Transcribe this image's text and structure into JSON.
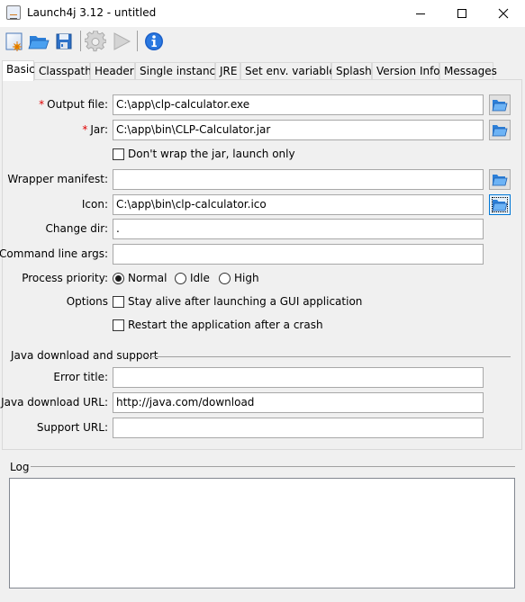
{
  "window": {
    "title": "Launch4j 3.12 - untitled",
    "minimize_label": "Minimize",
    "maximize_label": "Maximize",
    "close_label": "Close"
  },
  "toolbar": {
    "buttons": [
      {
        "name": "new-config",
        "icon": "new-document-icon"
      },
      {
        "name": "open-config",
        "icon": "open-folder-icon"
      },
      {
        "name": "save-config",
        "icon": "floppy-disk-icon"
      },
      {
        "name": "build-wrapper",
        "icon": "gear-icon"
      },
      {
        "name": "test-wrapper",
        "icon": "play-icon"
      },
      {
        "name": "about",
        "icon": "info-icon"
      }
    ]
  },
  "tabs": [
    {
      "label": "Basic",
      "active": true
    },
    {
      "label": "Classpath",
      "active": false
    },
    {
      "label": "Header",
      "active": false
    },
    {
      "label": "Single instance",
      "active": false
    },
    {
      "label": "JRE",
      "active": false
    },
    {
      "label": "Set env. variables",
      "active": false
    },
    {
      "label": "Splash",
      "active": false
    },
    {
      "label": "Version Info",
      "active": false
    },
    {
      "label": "Messages",
      "active": false
    }
  ],
  "basic": {
    "required_marker": "*",
    "output_file": {
      "label": "Output file:",
      "value": "C:\\app\\clp-calculator.exe"
    },
    "jar": {
      "label": "Jar:",
      "value": "C:\\app\\bin\\CLP-Calculator.jar"
    },
    "dont_wrap": {
      "label": "Don't wrap the jar, launch only",
      "checked": false
    },
    "wrapper_manifest": {
      "label": "Wrapper manifest:",
      "value": ""
    },
    "icon": {
      "label": "Icon:",
      "value": "C:\\app\\bin\\clp-calculator.ico"
    },
    "change_dir": {
      "label": "Change dir:",
      "value": "."
    },
    "cmd_args": {
      "label": "Command line args:",
      "value": ""
    },
    "process_priority": {
      "label": "Process priority:",
      "options": [
        {
          "label": "Normal",
          "selected": true
        },
        {
          "label": "Idle",
          "selected": false
        },
        {
          "label": "High",
          "selected": false
        }
      ]
    },
    "options": {
      "label": "Options",
      "stay_alive": {
        "label": "Stay alive after launching a GUI application",
        "checked": false
      },
      "restart": {
        "label": "Restart the application after a crash",
        "checked": false
      }
    },
    "java_download": {
      "title": "Java download and support",
      "error_title": {
        "label": "Error title:",
        "value": ""
      },
      "download_url": {
        "label": "Java download URL:",
        "value": "http://java.com/download"
      },
      "support_url": {
        "label": "Support URL:",
        "value": ""
      }
    }
  },
  "log": {
    "title": "Log",
    "content": ""
  }
}
